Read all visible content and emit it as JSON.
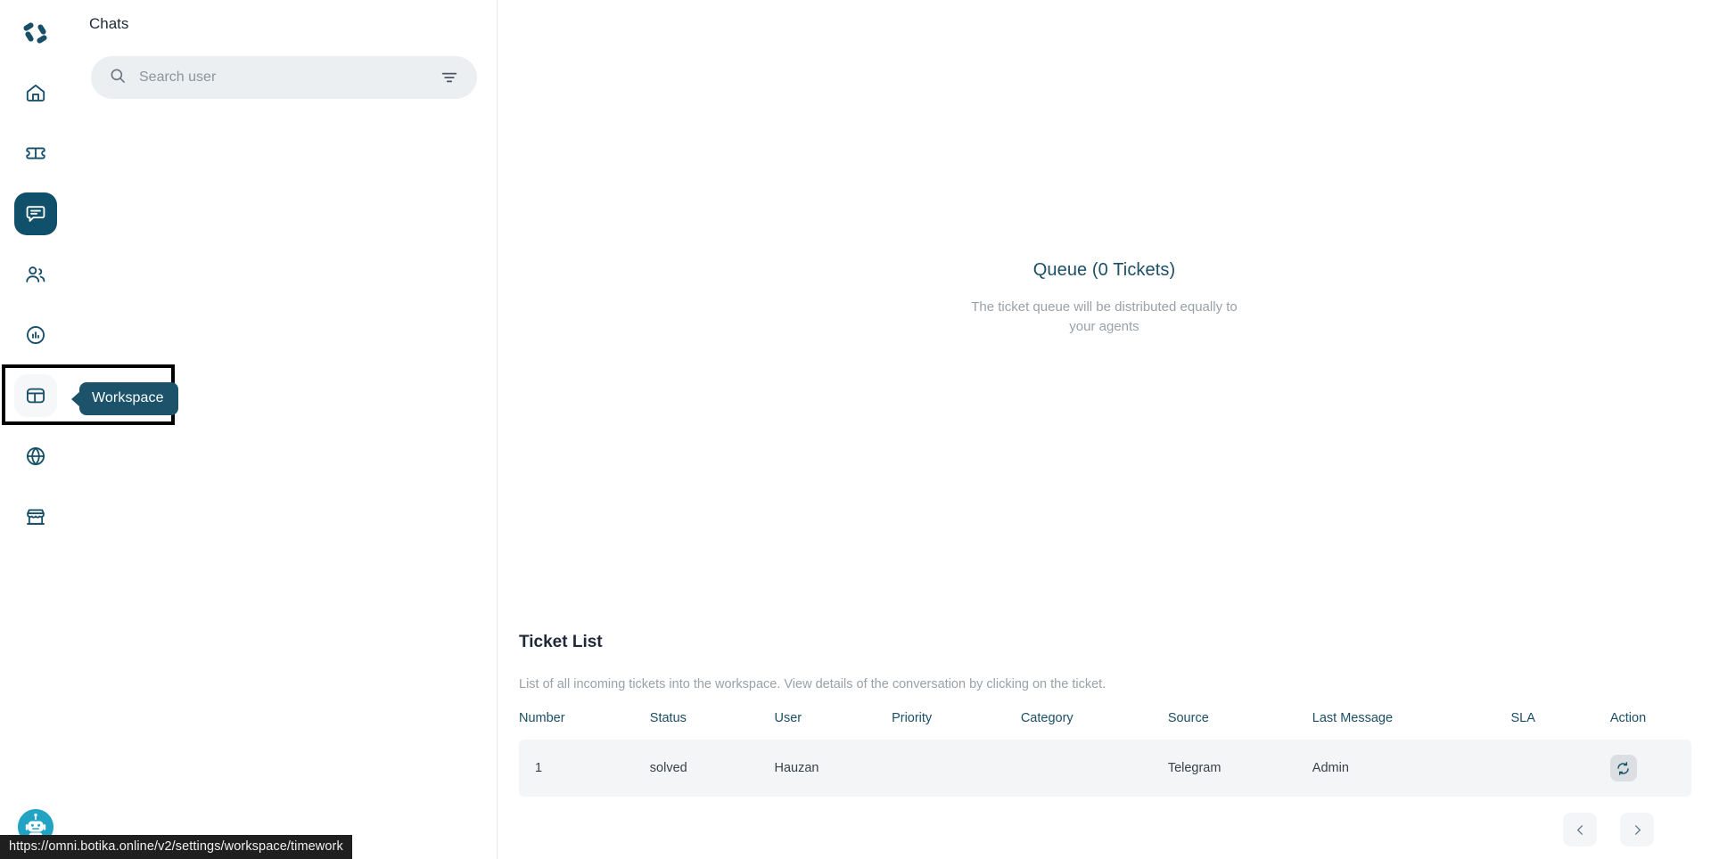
{
  "brand": {
    "logo_name": "botika-logo",
    "primary": "#11506a",
    "accent": "#1c4e66",
    "avatar_color": "#23a3c4"
  },
  "sidebar": {
    "items": [
      {
        "id": "home",
        "icon": "home-icon",
        "label": "Home",
        "active": false,
        "hovered": false
      },
      {
        "id": "tickets",
        "icon": "ticket-icon",
        "label": "Tickets",
        "active": false,
        "hovered": false
      },
      {
        "id": "chats",
        "icon": "chat-icon",
        "label": "Chats",
        "active": true,
        "hovered": false
      },
      {
        "id": "contacts",
        "icon": "users-icon",
        "label": "Contacts",
        "active": false,
        "hovered": false
      },
      {
        "id": "analytics",
        "icon": "bar-chart-icon",
        "label": "Analytics",
        "active": false,
        "hovered": false
      },
      {
        "id": "workspace",
        "icon": "workspace-icon",
        "label": "Workspace",
        "active": false,
        "hovered": true
      },
      {
        "id": "channels",
        "icon": "globe-icon",
        "label": "Channels",
        "active": false,
        "hovered": false
      },
      {
        "id": "store",
        "icon": "storefront-icon",
        "label": "Store",
        "active": false,
        "hovered": false
      }
    ],
    "avatar_name": "bot-avatar"
  },
  "tooltip": {
    "label": "Workspace",
    "visible": true
  },
  "chats_panel": {
    "title": "Chats",
    "search": {
      "value": "",
      "placeholder": "Search user",
      "icon": "search-icon",
      "filter_icon": "filter-icon"
    }
  },
  "queue": {
    "title": "Queue (0 Tickets)",
    "subtitle": "The ticket queue will be distributed equally to your agents",
    "ticket_count": 0
  },
  "ticket_list": {
    "title": "Ticket List",
    "description": "List of all incoming tickets into the workspace. View details of the conversation by clicking on the ticket.",
    "columns": [
      "Number",
      "Status",
      "User",
      "Priority",
      "Category",
      "Source",
      "Last Message",
      "SLA",
      "Action"
    ],
    "rows": [
      {
        "number": "1",
        "status": "solved",
        "user": "Hauzan",
        "priority": "",
        "category": "",
        "source": "Telegram",
        "last_message": "Admin",
        "sla": "",
        "action_icon": "refresh-icon"
      }
    ],
    "pagination": {
      "prev_icon": "chevron-left-icon",
      "next_icon": "chevron-right-icon"
    }
  },
  "status_bar": {
    "url": "https://omni.botika.online/v2/settings/workspace/timework"
  }
}
